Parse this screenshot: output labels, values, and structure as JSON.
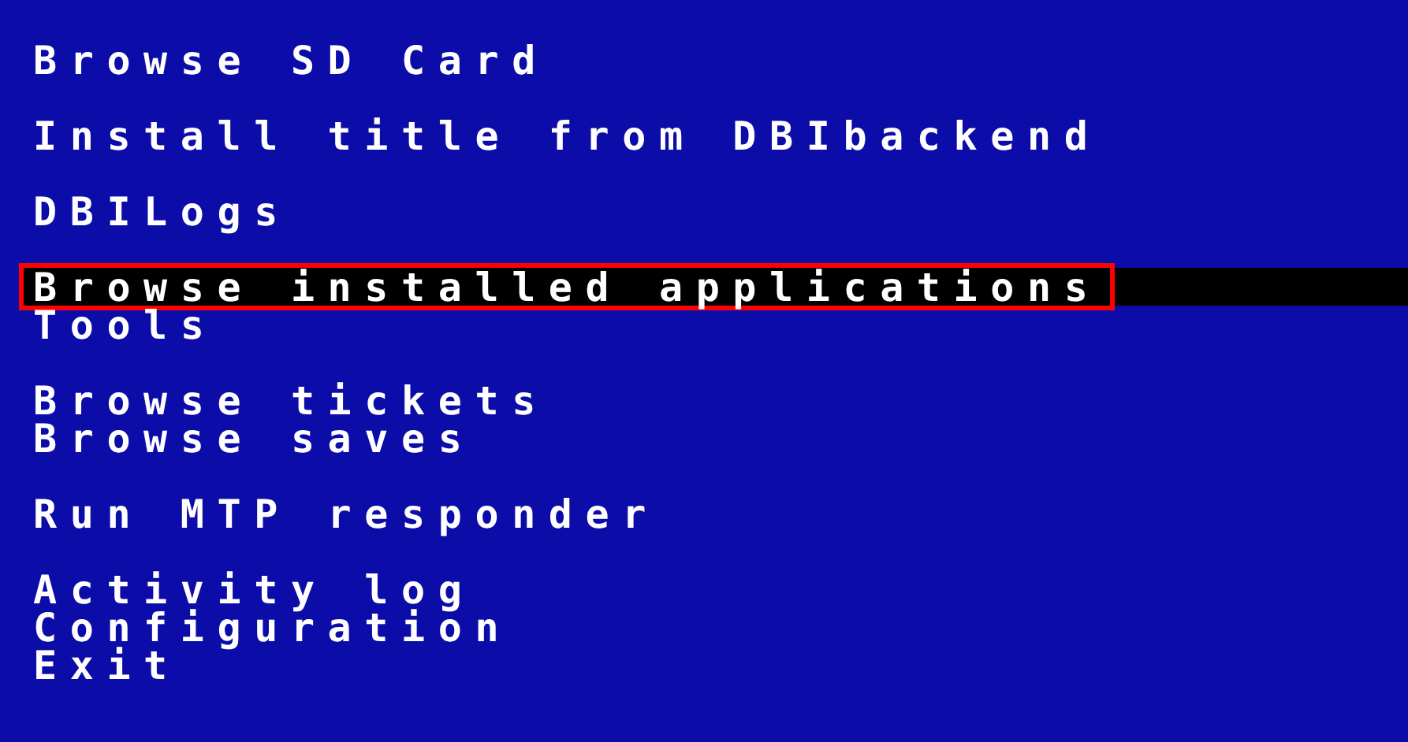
{
  "menu_groups": [
    {
      "items": [
        {
          "label": "Browse SD Card",
          "selected": false
        }
      ]
    },
    {
      "items": [
        {
          "label": "Install title from DBIbackend",
          "selected": false
        }
      ]
    },
    {
      "items": [
        {
          "label": "DBILogs",
          "selected": false
        }
      ]
    },
    {
      "items": [
        {
          "label": "Browse installed applications",
          "selected": true
        },
        {
          "label": "Tools",
          "selected": false
        }
      ]
    },
    {
      "items": [
        {
          "label": "Browse tickets",
          "selected": false
        },
        {
          "label": "Browse saves",
          "selected": false
        }
      ]
    },
    {
      "items": [
        {
          "label": "Run MTP responder",
          "selected": false
        }
      ]
    },
    {
      "items": [
        {
          "label": "Activity log",
          "selected": false
        },
        {
          "label": "Configuration",
          "selected": false
        },
        {
          "label": "Exit",
          "selected": false
        }
      ]
    }
  ]
}
